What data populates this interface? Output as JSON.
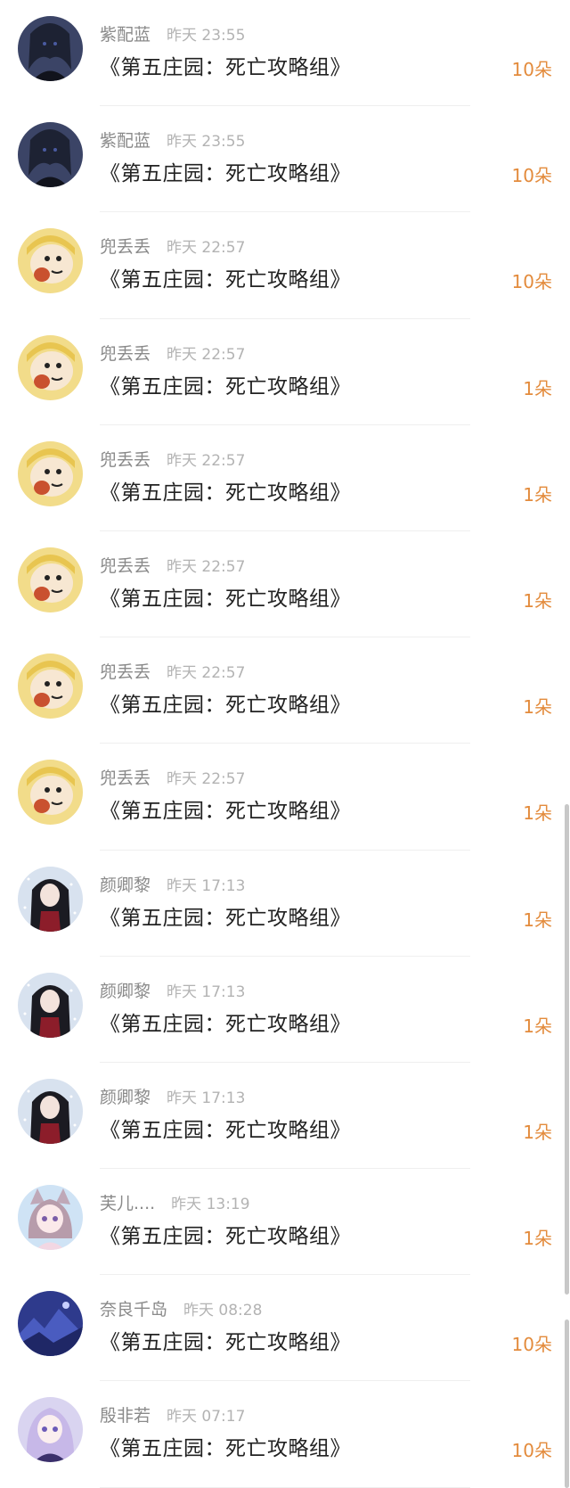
{
  "records": [
    {
      "name": "紫配蓝",
      "time": "昨天 23:55",
      "title": "《第五庄园：死亡攻略组》",
      "amount": "10朵",
      "avatar": "dark-gothic-girl"
    },
    {
      "name": "紫配蓝",
      "time": "昨天 23:55",
      "title": "《第五庄园：死亡攻略组》",
      "amount": "10朵",
      "avatar": "dark-gothic-girl"
    },
    {
      "name": "兜丢丢",
      "time": "昨天 22:57",
      "title": "《第五庄园：死亡攻略组》",
      "amount": "10朵",
      "avatar": "crayon-boy-yellow-hood"
    },
    {
      "name": "兜丢丢",
      "time": "昨天 22:57",
      "title": "《第五庄园：死亡攻略组》",
      "amount": "1朵",
      "avatar": "crayon-boy-yellow-hood"
    },
    {
      "name": "兜丢丢",
      "time": "昨天 22:57",
      "title": "《第五庄园：死亡攻略组》",
      "amount": "1朵",
      "avatar": "crayon-boy-yellow-hood"
    },
    {
      "name": "兜丢丢",
      "time": "昨天 22:57",
      "title": "《第五庄园：死亡攻略组》",
      "amount": "1朵",
      "avatar": "crayon-boy-yellow-hood"
    },
    {
      "name": "兜丢丢",
      "time": "昨天 22:57",
      "title": "《第五庄园：死亡攻略组》",
      "amount": "1朵",
      "avatar": "crayon-boy-yellow-hood"
    },
    {
      "name": "兜丢丢",
      "time": "昨天 22:57",
      "title": "《第五庄园：死亡攻略组》",
      "amount": "1朵",
      "avatar": "crayon-boy-yellow-hood"
    },
    {
      "name": "颜卿黎",
      "time": "昨天 17:13",
      "title": "《第五庄园：死亡攻略组》",
      "amount": "1朵",
      "avatar": "long-hair-girl-snow"
    },
    {
      "name": "颜卿黎",
      "time": "昨天 17:13",
      "title": "《第五庄园：死亡攻略组》",
      "amount": "1朵",
      "avatar": "long-hair-girl-snow"
    },
    {
      "name": "颜卿黎",
      "time": "昨天 17:13",
      "title": "《第五庄园：死亡攻略组》",
      "amount": "1朵",
      "avatar": "long-hair-girl-snow"
    },
    {
      "name": "芙儿....",
      "time": "昨天 13:19",
      "title": "《第五庄园：死亡攻略组》",
      "amount": "1朵",
      "avatar": "anime-girl-cat-ears"
    },
    {
      "name": "奈良千岛",
      "time": "昨天 08:28",
      "title": "《第五庄园：死亡攻略组》",
      "amount": "10朵",
      "avatar": "blue-landscape"
    },
    {
      "name": "殷非若",
      "time": "昨天 07:17",
      "title": "《第五庄园：死亡攻略组》",
      "amount": "10朵",
      "avatar": "anime-girl-purple"
    }
  ],
  "colors": {
    "amount": "#e38b3c",
    "name": "#8a8a8a",
    "time": "#b3b3b3",
    "title": "#222222"
  }
}
